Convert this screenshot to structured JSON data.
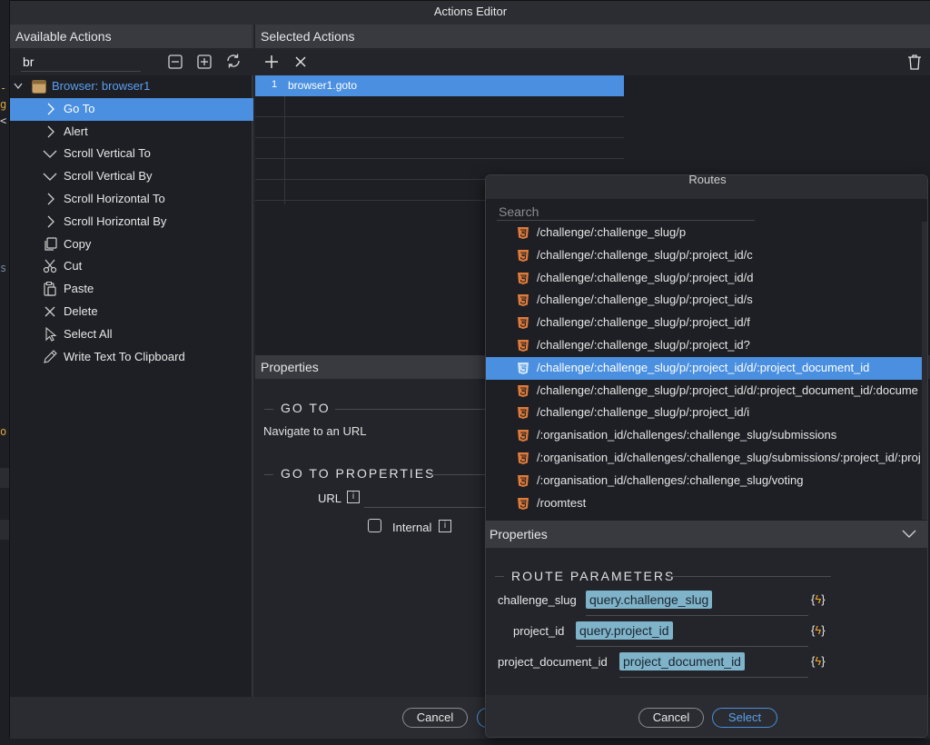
{
  "window": {
    "title": "Actions Editor"
  },
  "available_actions": {
    "header": "Available Actions",
    "search_value": "br",
    "tree": {
      "group_label": "Browser: browser1",
      "items": [
        {
          "label": "Go To",
          "icon": "chevron-right-icon",
          "selected": true
        },
        {
          "label": "Alert",
          "icon": "chevron-right-icon"
        },
        {
          "label": "Scroll Vertical To",
          "icon": "chevron-down-icon"
        },
        {
          "label": "Scroll Vertical By",
          "icon": "chevron-down-icon"
        },
        {
          "label": "Scroll Horizontal To",
          "icon": "chevron-right-icon"
        },
        {
          "label": "Scroll Horizontal By",
          "icon": "chevron-right-icon"
        },
        {
          "label": "Copy",
          "icon": "copy-icon"
        },
        {
          "label": "Cut",
          "icon": "scissors-icon"
        },
        {
          "label": "Paste",
          "icon": "paste-icon"
        },
        {
          "label": "Delete",
          "icon": "x-icon"
        },
        {
          "label": "Select All",
          "icon": "cursor-icon"
        },
        {
          "label": "Write Text To Clipboard",
          "icon": "pencil-icon"
        }
      ]
    }
  },
  "selected_actions": {
    "header": "Selected Actions",
    "rows": [
      {
        "index": "1",
        "label": "browser1.goto"
      }
    ]
  },
  "properties": {
    "header": "Properties",
    "section1_title": "GO TO",
    "section1_desc": "Navigate to an URL",
    "section2_title": "GO TO PROPERTIES",
    "url_label": "URL",
    "internal_label": "Internal"
  },
  "footer": {
    "cancel": "Cancel"
  },
  "routes": {
    "title": "Routes",
    "search_placeholder": "Search",
    "items": [
      "/challenge/:challenge_slug/p",
      "/challenge/:challenge_slug/p/:project_id/c",
      "/challenge/:challenge_slug/p/:project_id/d",
      "/challenge/:challenge_slug/p/:project_id/s",
      "/challenge/:challenge_slug/p/:project_id/f",
      "/challenge/:challenge_slug/p/:project_id?",
      "/challenge/:challenge_slug/p/:project_id/d/:project_document_id",
      "/challenge/:challenge_slug/p/:project_id/d/:project_document_id/:docume",
      "/challenge/:challenge_slug/p/:project_id/i",
      "/:organisation_id/challenges/:challenge_slug/submissions",
      "/:organisation_id/challenges/:challenge_slug/submissions/:project_id/:proj",
      "/:organisation_id/challenges/:challenge_slug/voting",
      "/roomtest"
    ],
    "selected_index": 6,
    "properties_header": "Properties",
    "params_title": "ROUTE PARAMETERS",
    "params": [
      {
        "name": "challenge_slug",
        "value": "query.challenge_slug"
      },
      {
        "name": "project_id",
        "value": "query.project_id"
      },
      {
        "name": "project_document_id",
        "value": "project_document_id"
      }
    ],
    "cancel": "Cancel",
    "select": "Select"
  },
  "colors": {
    "accent": "#4a8fe0",
    "html_icon": "#e07b39",
    "chip": "#7fb3c9",
    "bolt": "#f5a623"
  }
}
